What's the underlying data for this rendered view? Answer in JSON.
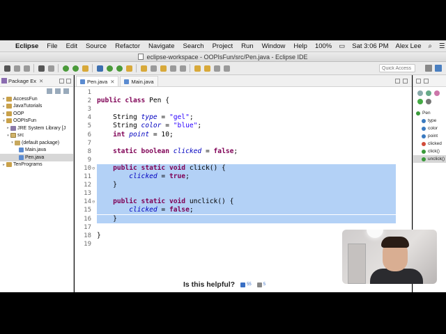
{
  "menubar": {
    "apple": "",
    "app": "Eclipse",
    "items": [
      "File",
      "Edit",
      "Source",
      "Refactor",
      "Navigate",
      "Search",
      "Project",
      "Run",
      "Window",
      "Help"
    ],
    "battery": "100%",
    "clock": "Sat 3:06 PM",
    "user": "Alex Lee"
  },
  "window": {
    "title": "eclipse-workspace - OOPIsFun/src/Pen.java - Eclipse IDE"
  },
  "toolbar": {
    "quick_access_placeholder": "Quick Access"
  },
  "package_explorer": {
    "tab_label": "Package Ex",
    "tree": [
      {
        "label": "AccessFun",
        "depth": 0,
        "expander": "▸",
        "icon": "proj"
      },
      {
        "label": "JavaTutorials",
        "depth": 0,
        "expander": "▸",
        "icon": "proj"
      },
      {
        "label": "OOP",
        "depth": 0,
        "expander": "▸",
        "icon": "proj"
      },
      {
        "label": "OOPIsFun",
        "depth": 0,
        "expander": "▾",
        "icon": "proj"
      },
      {
        "label": "JRE System Library [J",
        "depth": 1,
        "expander": "▸",
        "icon": "lib"
      },
      {
        "label": "src",
        "depth": 1,
        "expander": "▾",
        "icon": "src"
      },
      {
        "label": "(default package)",
        "depth": 2,
        "expander": "▾",
        "icon": "pkgi"
      },
      {
        "label": "Main.java",
        "depth": 3,
        "expander": "",
        "icon": "java"
      },
      {
        "label": "Pen.java",
        "depth": 3,
        "expander": "",
        "icon": "java",
        "selected": true
      },
      {
        "label": "TenPrograms",
        "depth": 0,
        "expander": "▸",
        "icon": "proj"
      }
    ]
  },
  "editor": {
    "tabs": [
      {
        "label": "Pen.java",
        "active": true
      },
      {
        "label": "Main.java",
        "active": false
      }
    ],
    "lines": [
      {
        "n": "1",
        "html": ""
      },
      {
        "n": "2",
        "html": "<span class=\"kw\">public class</span> Pen {"
      },
      {
        "n": "3",
        "html": ""
      },
      {
        "n": "4",
        "html": "    String <span class=\"fld\">type</span> = <span class=\"str\">\"gel\"</span>;"
      },
      {
        "n": "5",
        "html": "    String <span class=\"fld\">color</span> = <span class=\"str\">\"blue\"</span>;"
      },
      {
        "n": "6",
        "html": "    <span class=\"kw\">int</span> <span class=\"fld\">point</span> = 10;"
      },
      {
        "n": "7",
        "html": ""
      },
      {
        "n": "8",
        "html": "    <span class=\"kw\">static boolean</span> <span class=\"fld\">clicked</span> = <span class=\"kw\">false</span>;"
      },
      {
        "n": "9",
        "html": ""
      },
      {
        "n": "10",
        "fold": "⊖",
        "hl": true,
        "html": "    <span class=\"kw\">public static void</span> click() {"
      },
      {
        "n": "11",
        "hl": true,
        "html": "        <span class=\"fld\">clicked</span> = <span class=\"kw\">true</span>;"
      },
      {
        "n": "12",
        "hl": true,
        "html": "    }"
      },
      {
        "n": "13",
        "hl": true,
        "html": ""
      },
      {
        "n": "14",
        "fold": "⊖",
        "hl": true,
        "html": "    <span class=\"kw\">public static void</span> unclick() {"
      },
      {
        "n": "15",
        "hl": true,
        "html": "        <span class=\"fld\">clicked</span> = <span class=\"kw\">false</span>;"
      },
      {
        "n": "16",
        "hl": true,
        "html": "    }"
      },
      {
        "n": "17",
        "html": ""
      },
      {
        "n": "18",
        "html": "}"
      },
      {
        "n": "19",
        "html": ""
      }
    ]
  },
  "outline": {
    "root": "Pen",
    "members": [
      {
        "label": "type",
        "color": "#3a7ac0"
      },
      {
        "label": "color",
        "color": "#3a7ac0"
      },
      {
        "label": "point",
        "color": "#3a7ac0"
      },
      {
        "label": "clicked",
        "color": "#d14b3a"
      },
      {
        "label": "click()",
        "color": "#3a9a3a"
      },
      {
        "label": "unclick()",
        "color": "#3a9a3a",
        "selected": true
      }
    ]
  },
  "helpful": {
    "question": "Is this helpful?",
    "up_count": "55",
    "down_count": "5"
  }
}
